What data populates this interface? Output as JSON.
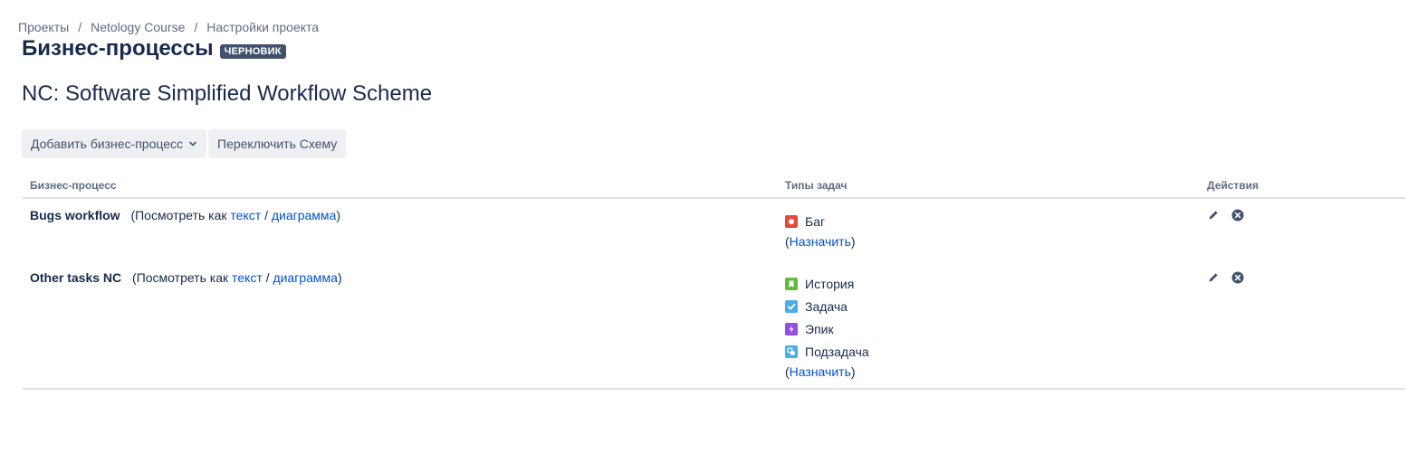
{
  "breadcrumb": {
    "items": [
      "Проекты",
      "Netology Course",
      "Настройки проекта"
    ],
    "separator": "/"
  },
  "header": {
    "title": "Бизнес-процессы",
    "badge": "ЧЕРНОВИК"
  },
  "scheme": {
    "name": "NC: Software Simplified Workflow Scheme"
  },
  "toolbar": {
    "add_label": "Добавить бизнес-процесс",
    "switch_label": "Переключить Схему"
  },
  "table": {
    "headers": {
      "workflow": "Бизнес-процесс",
      "types": "Типы задач",
      "actions": "Действия"
    },
    "view_prefix": "(Посмотреть как",
    "text_link": "текст",
    "slash": "/",
    "diagram_link": "диаграмма",
    "view_suffix": ")",
    "assign_open": "(",
    "assign_label": "Назначить",
    "assign_close": ")",
    "rows": [
      {
        "name": "Bugs workflow",
        "types": [
          {
            "label": "Баг",
            "icon": "bug-icon",
            "color": "#e5493a"
          }
        ]
      },
      {
        "name": "Other tasks NC",
        "types": [
          {
            "label": "История",
            "icon": "story-icon",
            "color": "#63ba3c"
          },
          {
            "label": "Задача",
            "icon": "task-icon",
            "color": "#4bade8"
          },
          {
            "label": "Эпик",
            "icon": "epic-icon",
            "color": "#904ee2"
          },
          {
            "label": "Подзадача",
            "icon": "subtask-icon",
            "color": "#4bade8"
          }
        ]
      }
    ]
  },
  "icons": {
    "edit": "pencil-icon",
    "delete": "delete-circle-icon"
  },
  "colors": {
    "link": "#0052cc",
    "badge_bg": "#42526e",
    "button_bg": "#eef0f3"
  }
}
